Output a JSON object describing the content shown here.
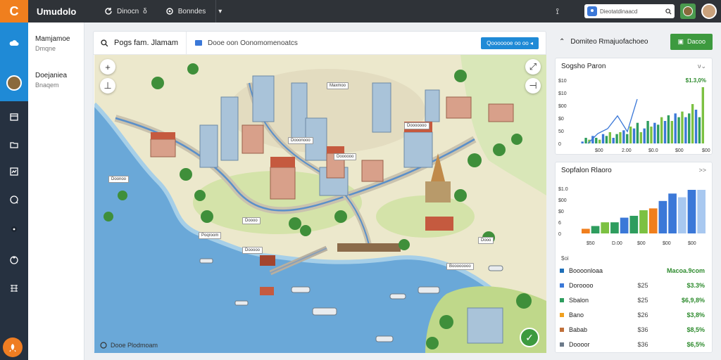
{
  "app": {
    "title": "Umudolo",
    "logo_glyph": "C"
  },
  "topnav": {
    "items": [
      {
        "label": "Dinocn",
        "icon": "refresh-icon",
        "suffix": "δ"
      },
      {
        "label": "Bonndes",
        "icon": "cloud-icon"
      }
    ]
  },
  "topbar": {
    "search_placeholder": "Dieotatdinaacd",
    "search_icon": "search-icon"
  },
  "sidebar": {
    "projects": [
      {
        "name": "Mamjamoe",
        "sub": "Dmqne"
      },
      {
        "name": "Doejaniea",
        "sub": "Bnaqem"
      }
    ]
  },
  "main": {
    "search_label": "Pogs fam. Jlamam",
    "breadcrumb": "Dooe oon Oonomomenoatcs",
    "primary_button": "Qooooooe oo oo ◂",
    "footer_text": "Dooe Plodmoam",
    "map_labels": [
      "Doonoo",
      "Poqroom",
      "Doooo",
      "Maxmoo",
      "Dooooooo",
      "Dooonooo",
      "Doooooo",
      "Dooooo",
      "Dooo",
      "Boooooooo"
    ]
  },
  "right_panel": {
    "header_title": "Domiteo Rmajuofachoeo",
    "header_button": "Dacoo",
    "card1": {
      "title": "Sogsho Paron",
      "chev": "ν⌄",
      "y_labels": [
        "$10",
        "$10",
        "$00",
        "$0",
        "50",
        "0"
      ],
      "x_labels": [
        "$00",
        "2.00",
        "$0.0",
        "$00",
        "$00"
      ],
      "value_label": "$1.3,0%"
    },
    "card2": {
      "title": "Sopfalon Rlaoro",
      "chev": ">>",
      "y_labels": [
        "$1.0",
        "$00",
        "$0",
        "6",
        "0"
      ],
      "x_labels": [
        "$50",
        "D.00",
        "$00",
        "$00",
        "$00"
      ],
      "section_label": "$oi",
      "rows": [
        {
          "label": "Boooonloaa",
          "pct": "",
          "value": "Macoa.9com",
          "color": "#1f6fb8"
        },
        {
          "label": "Doroooo",
          "pct": "$25",
          "value": "$3.3%",
          "color": "#3b78d8"
        },
        {
          "label": "Sbalon",
          "pct": "$25",
          "value": "$6,9,8%",
          "color": "#2e9d5e"
        },
        {
          "label": "Bano",
          "pct": "$26",
          "value": "$3,8%",
          "color": "#f0a020"
        },
        {
          "label": "Babab",
          "pct": "$36",
          "value": "$8,5%",
          "color": "#c0703a"
        },
        {
          "label": "Doooor",
          "pct": "$36",
          "value": "$6,5%",
          "color": "#6c7a8a"
        }
      ]
    }
  },
  "chart_data": [
    {
      "type": "bar",
      "title": "Sogsho Paron",
      "values": [
        1,
        3,
        2,
        4,
        3,
        2,
        5,
        4,
        6,
        3,
        5,
        6,
        7,
        5,
        9,
        8,
        11,
        6,
        8,
        12,
        9,
        11,
        10,
        14,
        12,
        15,
        12,
        16,
        14,
        17,
        14,
        16,
        21,
        18,
        14,
        30
      ],
      "line": [
        0,
        10,
        15,
        28,
        12,
        45
      ]
    },
    {
      "type": "bar",
      "title": "Sopfalon Rlaoro",
      "values": [
        5,
        8,
        12,
        12,
        17,
        19,
        25,
        27,
        35,
        43,
        39,
        47,
        47
      ],
      "colors": [
        "#f07f1e",
        "#2e9d5e",
        "#7cc142",
        "#2e9d5e",
        "#3b78d8",
        "#2e9d5e",
        "#7cc142",
        "#f07f1e",
        "#3b78d8",
        "#3b78d8",
        "#a8c8f0",
        "#3b78d8",
        "#a8c8f0"
      ]
    }
  ]
}
